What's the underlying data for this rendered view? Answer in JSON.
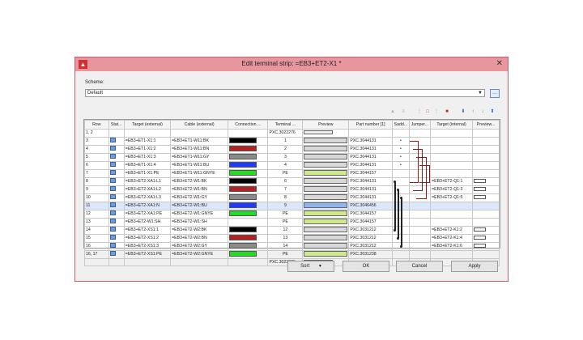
{
  "window": {
    "title": "Edit terminal strip: =EB3+ET2-X1 *"
  },
  "scheme": {
    "label": "Scheme:",
    "value": "Default"
  },
  "columns": [
    "Row",
    "Stat...",
    "Target (external)",
    "Cable (external)",
    "Connection ...",
    "Terminal ...",
    "Preview",
    "Part number [1]",
    "Sadd...",
    "Jumper...",
    "Target (internal)",
    "Preview..."
  ],
  "header_row": {
    "row": "1, 2",
    "terminal": "PXC.3022276"
  },
  "rows": [
    {
      "row": "3",
      "target_ext": "=EB3+ET1-X1:1",
      "cable": "=EB3+ET1-W11:BK",
      "color": "#000000",
      "terminal": "1",
      "part": "PXC.3044131",
      "saddle": "•",
      "target_int": "",
      "preview_int": false
    },
    {
      "row": "4",
      "target_ext": "=EB3+ET1-X1:2",
      "cable": "=EB3+ET1-W11:BN",
      "color": "#b22222",
      "terminal": "2",
      "part": "PXC.3044131",
      "saddle": "•",
      "target_int": "",
      "preview_int": false
    },
    {
      "row": "5",
      "target_ext": "=EB3+ET1-X1:3",
      "cable": "=EB3+ET1-W11:GY",
      "color": "#8a8a8a",
      "terminal": "3",
      "part": "PXC.3044131",
      "saddle": "•",
      "target_int": "",
      "preview_int": false
    },
    {
      "row": "6",
      "target_ext": "=EB3+ET1-X1:4",
      "cable": "=EB3+ET1-W11:BU",
      "color": "#1e3cff",
      "terminal": "4",
      "part": "PXC.3044131",
      "saddle": "•",
      "target_int": "",
      "preview_int": false
    },
    {
      "row": "7",
      "target_ext": "=EB3+ET1-X1:PE",
      "cable": "=EB3+ET1-W11:GNYE",
      "color": "#22dd22",
      "terminal": "PE",
      "part": "PXC.3044157",
      "saddle": "",
      "target_int": "",
      "preview_int": false
    },
    {
      "row": "8",
      "target_ext": "=EB3+ET2-XA1:L1",
      "cable": "=EB3+ET2-W1:BK",
      "color": "#000000",
      "terminal": "6",
      "part": "PXC.3044131",
      "saddle": "",
      "target_int": "=EB3+ET2-Q1:1",
      "preview_int": true
    },
    {
      "row": "9",
      "target_ext": "=EB3+ET2-XA1:L2",
      "cable": "=EB3+ET2-W1:BN",
      "color": "#b22222",
      "terminal": "7",
      "part": "PXC.3044131",
      "saddle": "",
      "target_int": "=EB3+ET2-Q1:3",
      "preview_int": true
    },
    {
      "row": "10",
      "target_ext": "=EB3+ET2-XA1:L3",
      "cable": "=EB3+ET2-W1:GY",
      "color": "#8a8a8a",
      "terminal": "8",
      "part": "PXC.3044131",
      "saddle": "",
      "target_int": "=EB3+ET2-Q1:5",
      "preview_int": true
    },
    {
      "row": "11",
      "target_ext": "=EB3+ET2-XA1:N",
      "cable": "=EB3+ET2-W1:BU",
      "color": "#1e3cff",
      "terminal": "9",
      "part": "PXC.3046456",
      "saddle": "",
      "target_int": "",
      "preview_int": false
    },
    {
      "row": "12",
      "target_ext": "=EB3+ET2-XA1:PE",
      "cable": "=EB3+ET2-W1:GNYE",
      "color": "#22dd22",
      "terminal": "PE",
      "part": "PXC.3044157",
      "saddle": "",
      "target_int": "",
      "preview_int": false
    },
    {
      "row": "13",
      "target_ext": "=EB3+ET2-W1:SH",
      "cable": "=EB3+ET2-W1:SH",
      "color": "",
      "terminal": "PE",
      "part": "PXC.3044157",
      "saddle": "",
      "target_int": "",
      "preview_int": false
    },
    {
      "row": "14",
      "target_ext": "=EB3+ET2-XS1:1",
      "cable": "=EB3+ET2-W2:BK",
      "color": "#000000",
      "terminal": "12",
      "part": "PXC.3031212",
      "saddle": "",
      "target_int": "=EB3+ET2-K1:2",
      "preview_int": true
    },
    {
      "row": "15",
      "target_ext": "=EB3+ET2-XS1:2",
      "cable": "=EB3+ET2-W2:BN",
      "color": "#b22222",
      "terminal": "13",
      "part": "PXC.3031212",
      "saddle": "",
      "target_int": "=EB3+ET2-K1:4",
      "preview_int": true
    },
    {
      "row": "16",
      "target_ext": "=EB3+ET2-XS1:3",
      "cable": "=EB3+ET2-W2:GY",
      "color": "#8a8a8a",
      "terminal": "14",
      "part": "PXC.3031212",
      "saddle": "",
      "target_int": "=EB3+ET2-K1:6",
      "preview_int": true
    },
    {
      "row": "16, 17",
      "target_ext": "=EB3+ET2-XS1:PE",
      "cable": "=EB3+ET2-W2:GNYE",
      "color": "#22dd22",
      "terminal": "PE",
      "part": "PXC.3031238",
      "saddle": "",
      "target_int": "",
      "preview_int": false
    }
  ],
  "footer_row": {
    "terminal": "PXC.3022276"
  },
  "buttons": {
    "sort": "Sort",
    "ok": "OK",
    "cancel": "Cancel",
    "apply": "Apply"
  }
}
